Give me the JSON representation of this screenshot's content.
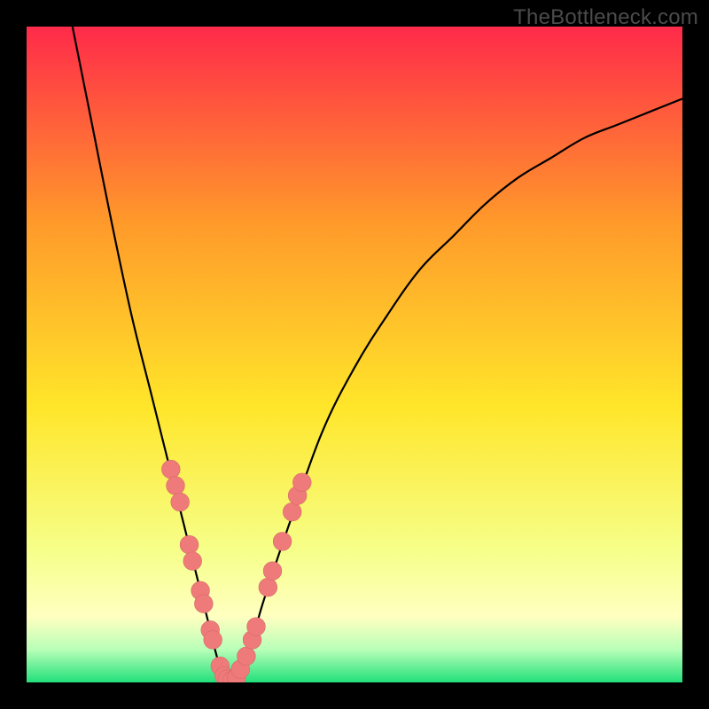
{
  "watermark": "TheBottleneck.com",
  "colors": {
    "bgBlack": "#000000",
    "gradientTop": "#ff2a4a",
    "gradientUpperMid": "#ff9a2a",
    "gradientMid": "#ffe62a",
    "gradientLowerMid": "#f6ff8a",
    "gradientLightYellow": "#ffffc0",
    "gradientPaleGreen": "#b8ffb8",
    "gradientBottom": "#22e07a",
    "curveStroke": "#000000",
    "markerFill": "#ef7a7a",
    "markerStroke": "#d46a6a"
  },
  "chart_data": {
    "type": "line",
    "title": "",
    "xlabel": "",
    "ylabel": "",
    "xlim": [
      0,
      100
    ],
    "ylim": [
      0,
      100
    ],
    "grid": false,
    "legend": false,
    "series": [
      {
        "name": "bottleneck-curve",
        "x": [
          7,
          10,
          13,
          16,
          19,
          21,
          23,
          25,
          27,
          28,
          29,
          30,
          31,
          32,
          34,
          36,
          40,
          45,
          50,
          55,
          60,
          65,
          70,
          75,
          80,
          85,
          90,
          95,
          100
        ],
        "y": [
          100,
          85,
          70,
          56,
          44,
          36,
          28,
          20,
          12,
          8,
          4,
          1,
          0,
          1,
          5,
          12,
          24,
          38,
          48,
          56,
          63,
          68,
          73,
          77,
          80,
          83,
          85,
          87,
          89
        ]
      }
    ],
    "markers": [
      {
        "x": 22.0,
        "y": 32.5
      },
      {
        "x": 22.7,
        "y": 30.0
      },
      {
        "x": 23.4,
        "y": 27.5
      },
      {
        "x": 24.8,
        "y": 21.0
      },
      {
        "x": 25.3,
        "y": 18.5
      },
      {
        "x": 26.5,
        "y": 14.0
      },
      {
        "x": 27.0,
        "y": 12.0
      },
      {
        "x": 28.0,
        "y": 8.0
      },
      {
        "x": 28.4,
        "y": 6.5
      },
      {
        "x": 29.5,
        "y": 2.5
      },
      {
        "x": 30.1,
        "y": 1.0
      },
      {
        "x": 30.6,
        "y": 0.5
      },
      {
        "x": 31.3,
        "y": 0.3
      },
      {
        "x": 32.0,
        "y": 0.7
      },
      {
        "x": 32.6,
        "y": 2.0
      },
      {
        "x": 33.5,
        "y": 4.0
      },
      {
        "x": 34.4,
        "y": 6.5
      },
      {
        "x": 35.0,
        "y": 8.5
      },
      {
        "x": 36.8,
        "y": 14.5
      },
      {
        "x": 37.5,
        "y": 17.0
      },
      {
        "x": 39.0,
        "y": 21.5
      },
      {
        "x": 40.5,
        "y": 26.0
      },
      {
        "x": 41.3,
        "y": 28.5
      },
      {
        "x": 42.0,
        "y": 30.5
      }
    ],
    "marker_radius_percent": 1.4
  }
}
